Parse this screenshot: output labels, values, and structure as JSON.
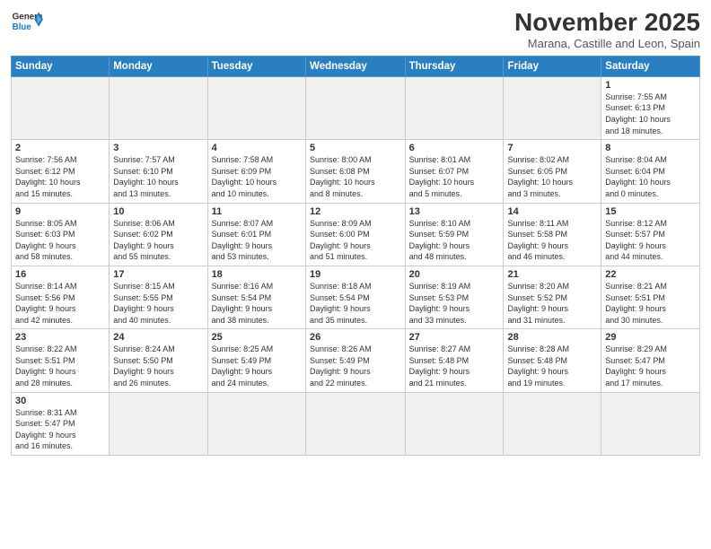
{
  "header": {
    "logo_text_general": "General",
    "logo_text_blue": "Blue",
    "month_title": "November 2025",
    "subtitle": "Marana, Castille and Leon, Spain"
  },
  "days_of_week": [
    "Sunday",
    "Monday",
    "Tuesday",
    "Wednesday",
    "Thursday",
    "Friday",
    "Saturday"
  ],
  "weeks": [
    [
      {
        "day": "",
        "info": ""
      },
      {
        "day": "",
        "info": ""
      },
      {
        "day": "",
        "info": ""
      },
      {
        "day": "",
        "info": ""
      },
      {
        "day": "",
        "info": ""
      },
      {
        "day": "",
        "info": ""
      },
      {
        "day": "1",
        "info": "Sunrise: 7:55 AM\nSunset: 6:13 PM\nDaylight: 10 hours\nand 18 minutes."
      }
    ],
    [
      {
        "day": "2",
        "info": "Sunrise: 7:56 AM\nSunset: 6:12 PM\nDaylight: 10 hours\nand 15 minutes."
      },
      {
        "day": "3",
        "info": "Sunrise: 7:57 AM\nSunset: 6:10 PM\nDaylight: 10 hours\nand 13 minutes."
      },
      {
        "day": "4",
        "info": "Sunrise: 7:58 AM\nSunset: 6:09 PM\nDaylight: 10 hours\nand 10 minutes."
      },
      {
        "day": "5",
        "info": "Sunrise: 8:00 AM\nSunset: 6:08 PM\nDaylight: 10 hours\nand 8 minutes."
      },
      {
        "day": "6",
        "info": "Sunrise: 8:01 AM\nSunset: 6:07 PM\nDaylight: 10 hours\nand 5 minutes."
      },
      {
        "day": "7",
        "info": "Sunrise: 8:02 AM\nSunset: 6:05 PM\nDaylight: 10 hours\nand 3 minutes."
      },
      {
        "day": "8",
        "info": "Sunrise: 8:04 AM\nSunset: 6:04 PM\nDaylight: 10 hours\nand 0 minutes."
      }
    ],
    [
      {
        "day": "9",
        "info": "Sunrise: 8:05 AM\nSunset: 6:03 PM\nDaylight: 9 hours\nand 58 minutes."
      },
      {
        "day": "10",
        "info": "Sunrise: 8:06 AM\nSunset: 6:02 PM\nDaylight: 9 hours\nand 55 minutes."
      },
      {
        "day": "11",
        "info": "Sunrise: 8:07 AM\nSunset: 6:01 PM\nDaylight: 9 hours\nand 53 minutes."
      },
      {
        "day": "12",
        "info": "Sunrise: 8:09 AM\nSunset: 6:00 PM\nDaylight: 9 hours\nand 51 minutes."
      },
      {
        "day": "13",
        "info": "Sunrise: 8:10 AM\nSunset: 5:59 PM\nDaylight: 9 hours\nand 48 minutes."
      },
      {
        "day": "14",
        "info": "Sunrise: 8:11 AM\nSunset: 5:58 PM\nDaylight: 9 hours\nand 46 minutes."
      },
      {
        "day": "15",
        "info": "Sunrise: 8:12 AM\nSunset: 5:57 PM\nDaylight: 9 hours\nand 44 minutes."
      }
    ],
    [
      {
        "day": "16",
        "info": "Sunrise: 8:14 AM\nSunset: 5:56 PM\nDaylight: 9 hours\nand 42 minutes."
      },
      {
        "day": "17",
        "info": "Sunrise: 8:15 AM\nSunset: 5:55 PM\nDaylight: 9 hours\nand 40 minutes."
      },
      {
        "day": "18",
        "info": "Sunrise: 8:16 AM\nSunset: 5:54 PM\nDaylight: 9 hours\nand 38 minutes."
      },
      {
        "day": "19",
        "info": "Sunrise: 8:18 AM\nSunset: 5:54 PM\nDaylight: 9 hours\nand 35 minutes."
      },
      {
        "day": "20",
        "info": "Sunrise: 8:19 AM\nSunset: 5:53 PM\nDaylight: 9 hours\nand 33 minutes."
      },
      {
        "day": "21",
        "info": "Sunrise: 8:20 AM\nSunset: 5:52 PM\nDaylight: 9 hours\nand 31 minutes."
      },
      {
        "day": "22",
        "info": "Sunrise: 8:21 AM\nSunset: 5:51 PM\nDaylight: 9 hours\nand 30 minutes."
      }
    ],
    [
      {
        "day": "23",
        "info": "Sunrise: 8:22 AM\nSunset: 5:51 PM\nDaylight: 9 hours\nand 28 minutes."
      },
      {
        "day": "24",
        "info": "Sunrise: 8:24 AM\nSunset: 5:50 PM\nDaylight: 9 hours\nand 26 minutes."
      },
      {
        "day": "25",
        "info": "Sunrise: 8:25 AM\nSunset: 5:49 PM\nDaylight: 9 hours\nand 24 minutes."
      },
      {
        "day": "26",
        "info": "Sunrise: 8:26 AM\nSunset: 5:49 PM\nDaylight: 9 hours\nand 22 minutes."
      },
      {
        "day": "27",
        "info": "Sunrise: 8:27 AM\nSunset: 5:48 PM\nDaylight: 9 hours\nand 21 minutes."
      },
      {
        "day": "28",
        "info": "Sunrise: 8:28 AM\nSunset: 5:48 PM\nDaylight: 9 hours\nand 19 minutes."
      },
      {
        "day": "29",
        "info": "Sunrise: 8:29 AM\nSunset: 5:47 PM\nDaylight: 9 hours\nand 17 minutes."
      }
    ],
    [
      {
        "day": "30",
        "info": "Sunrise: 8:31 AM\nSunset: 5:47 PM\nDaylight: 9 hours\nand 16 minutes."
      },
      {
        "day": "",
        "info": ""
      },
      {
        "day": "",
        "info": ""
      },
      {
        "day": "",
        "info": ""
      },
      {
        "day": "",
        "info": ""
      },
      {
        "day": "",
        "info": ""
      },
      {
        "day": "",
        "info": ""
      }
    ]
  ]
}
